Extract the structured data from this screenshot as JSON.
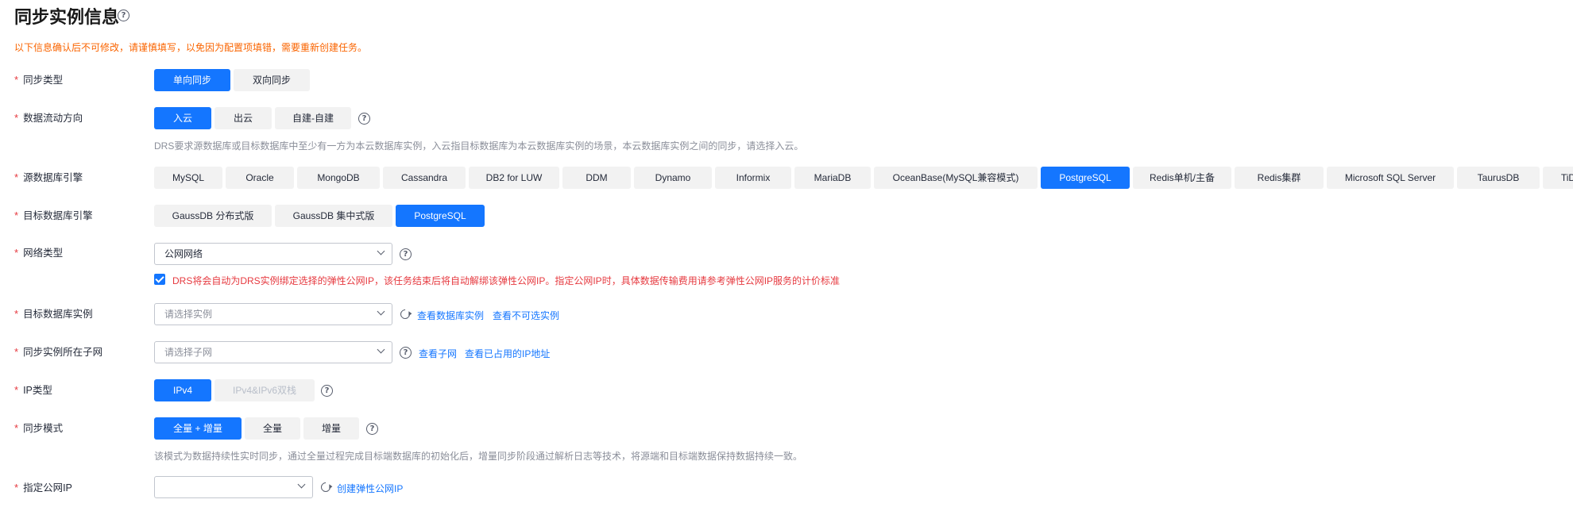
{
  "title": "同步实例信息",
  "notice": "以下信息确认后不可修改，请谨慎填写，以免因为配置项填错，需要重新创建任务。",
  "required_mark": "*",
  "sync_type": {
    "label": "同步类型",
    "options": [
      "单向同步",
      "双向同步"
    ],
    "selected": "单向同步"
  },
  "flow_direction": {
    "label": "数据流动方向",
    "options": [
      "入云",
      "出云",
      "自建-自建"
    ],
    "selected": "入云",
    "hint": "DRS要求源数据库或目标数据库中至少有一方为本云数据库实例，入云指目标数据库为本云数据库实例的场景，本云数据库实例之间的同步，请选择入云。"
  },
  "source_engine": {
    "label": "源数据库引擎",
    "options": [
      "MySQL",
      "Oracle",
      "MongoDB",
      "Cassandra",
      "DB2 for LUW",
      "DDM",
      "Dynamo",
      "Informix",
      "MariaDB",
      "OceanBase(MySQL兼容模式)",
      "PostgreSQL",
      "Redis单机/主备",
      "Redis集群",
      "Microsoft SQL Server",
      "TaurusDB",
      "TiDB"
    ],
    "selected": "PostgreSQL"
  },
  "target_engine": {
    "label": "目标数据库引擎",
    "options": [
      "GaussDB 分布式版",
      "GaussDB 集中式版",
      "PostgreSQL"
    ],
    "selected": "PostgreSQL"
  },
  "network_type": {
    "label": "网络类型",
    "value": "公网网络",
    "eip_checkbox_text": "DRS将会自动为DRS实例绑定选择的弹性公网IP，该任务结束后将自动解绑该弹性公网IP。指定公网IP时，具体数据传输费用请参考弹性公网IP服务的计价标准"
  },
  "target_instance": {
    "label": "目标数据库实例",
    "placeholder": "请选择实例",
    "links": [
      "查看数据库实例",
      "查看不可选实例"
    ]
  },
  "subnet": {
    "label": "同步实例所在子网",
    "placeholder": "请选择子网",
    "links": [
      "查看子网",
      "查看已占用的IP地址"
    ]
  },
  "ip_type": {
    "label": "IP类型",
    "options": [
      "IPv4",
      "IPv4&IPv6双栈"
    ],
    "selected": "IPv4"
  },
  "sync_mode": {
    "label": "同步模式",
    "options": [
      "全量 + 增量",
      "全量",
      "增量"
    ],
    "selected": "全量 + 增量",
    "hint": "该模式为数据持续性实时同步，通过全量过程完成目标端数据库的初始化后，增量同步阶段通过解析日志等技术，将源端和目标端数据保持数据持续一致。"
  },
  "public_ip": {
    "label": "指定公网IP",
    "value": "",
    "link": "创建弹性公网IP"
  }
}
